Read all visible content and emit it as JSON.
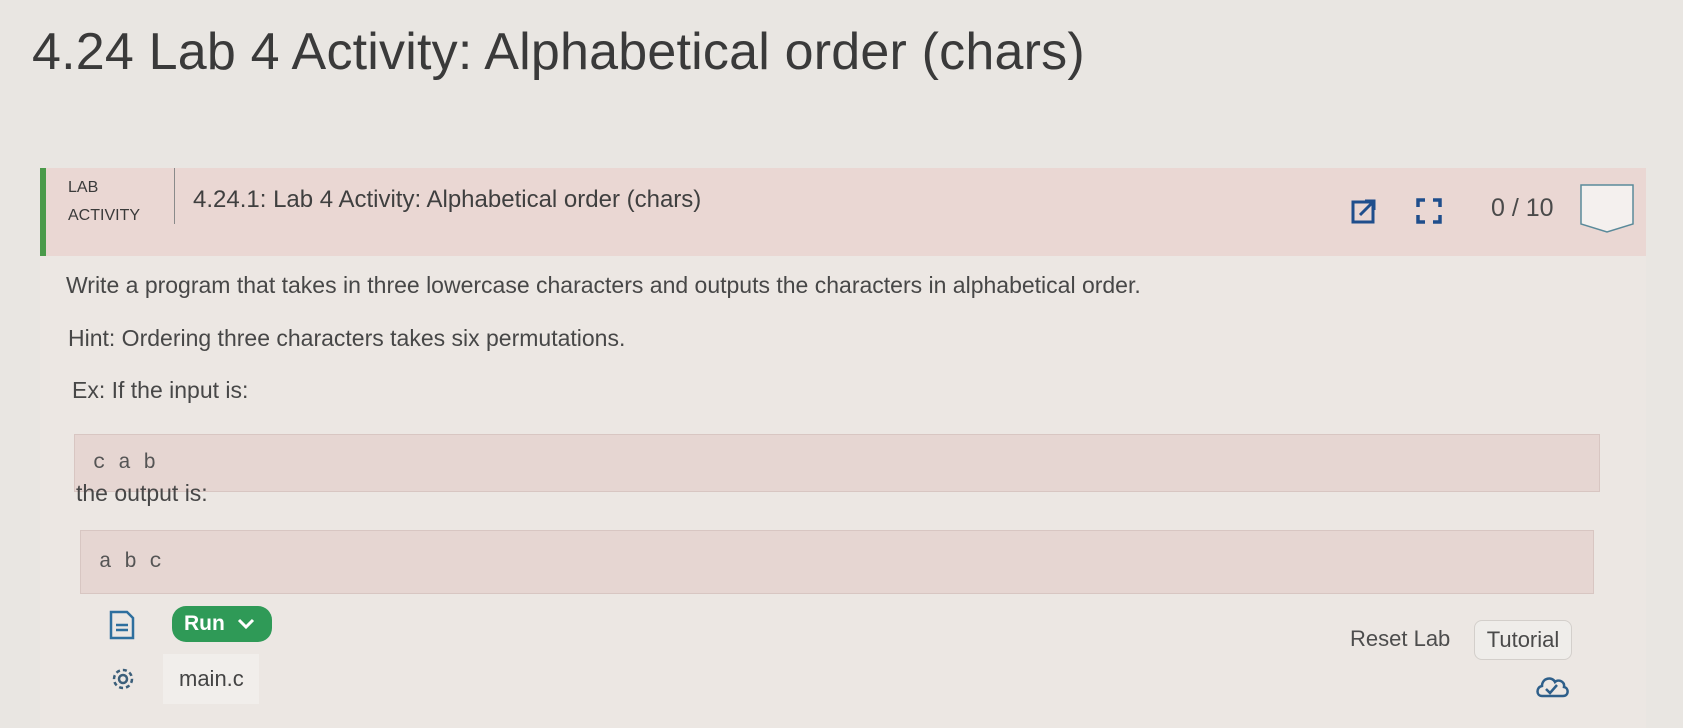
{
  "page": {
    "title": "4.24 Lab 4 Activity: Alphabetical order (chars)"
  },
  "lab_header": {
    "tag_line1": "LAB",
    "tag_line2": "ACTIVITY",
    "title": "4.24.1: Lab 4 Activity: Alphabetical order (chars)",
    "score": "0 / 10"
  },
  "instructions": {
    "prompt": "Write a program that takes in three lowercase characters and outputs the characters in alphabetical order.",
    "hint": "Hint: Ordering three characters takes six permutations.",
    "example_intro": "Ex: If the input is:",
    "example_input": "c a b",
    "output_intro": "the output is:",
    "example_output": "a b c"
  },
  "toolbar": {
    "run_label": "Run",
    "file_name": "main.c",
    "reset_label": "Reset Lab",
    "tutorial_label": "Tutorial"
  },
  "colors": {
    "header_accent": "#4a9a4a",
    "header_bg": "#ead7d3",
    "run_button": "#2f9a57",
    "icon_blue": "#1f4e8c"
  },
  "icons": {
    "popout": "external-link-icon",
    "fullscreen": "fullscreen-icon",
    "file": "file-icon",
    "gear": "gear-icon",
    "cloud": "cloud-check-icon",
    "chevron": "chevron-down-icon"
  }
}
